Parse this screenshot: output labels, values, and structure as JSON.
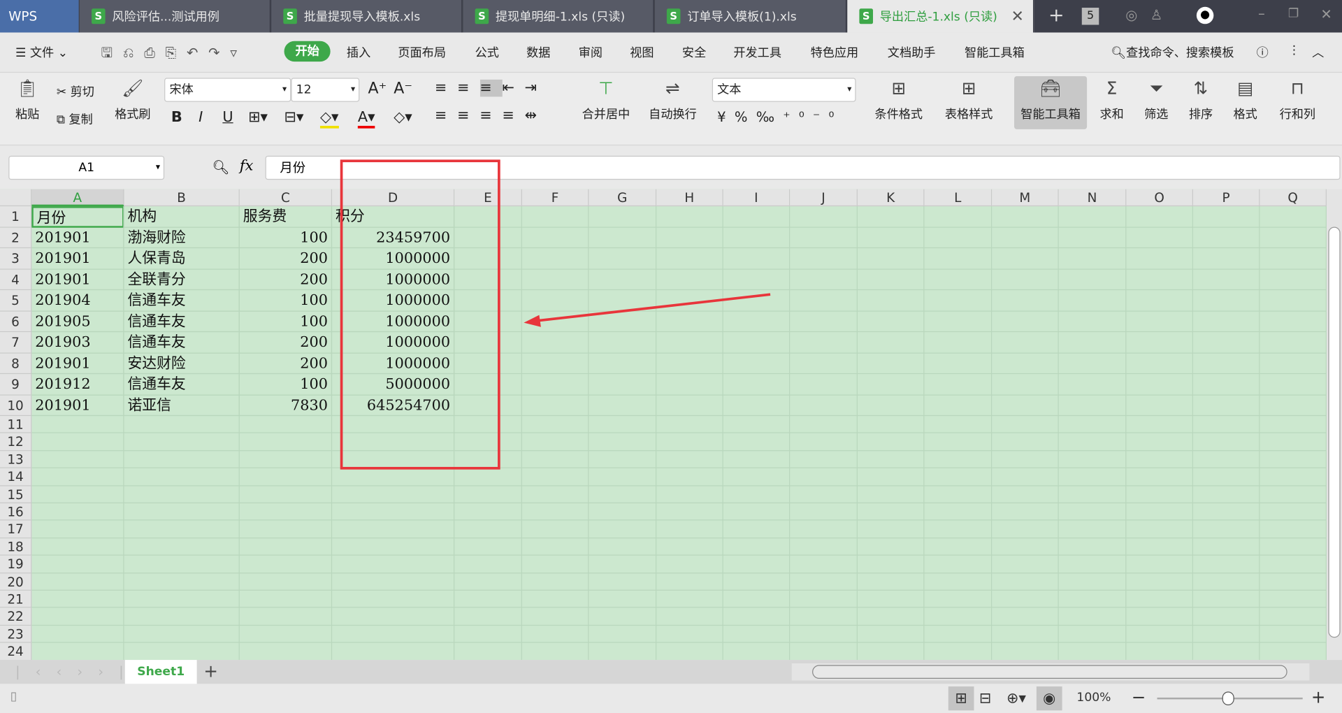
{
  "app": {
    "logo": "WPS"
  },
  "tabs": [
    {
      "label": "风险评估...测试用例"
    },
    {
      "label": "批量提现导入模板.xls"
    },
    {
      "label": "提现单明细-1.xls (只读)"
    },
    {
      "label": "订单导入模板(1).xls"
    },
    {
      "label": "导出汇总-1.xls (只读)"
    }
  ],
  "tabbar": {
    "count": "5"
  },
  "menu": {
    "file": "文件",
    "items": [
      "开始",
      "插入",
      "页面布局",
      "公式",
      "数据",
      "审阅",
      "视图",
      "安全",
      "开发工具",
      "特色应用",
      "文档助手",
      "智能工具箱"
    ],
    "search": "查找命令、搜索模板"
  },
  "ribbon": {
    "paste": "粘贴",
    "cut": "剪切",
    "copy": "复制",
    "format_painter": "格式刷",
    "font": "宋体",
    "size": "12",
    "merge": "合并居中",
    "wrap": "自动换行",
    "number_format": "文本",
    "cond_format": "条件格式",
    "table_style": "表格样式",
    "toolbox": "智能工具箱",
    "sum": "求和",
    "filter": "筛选",
    "sort": "排序",
    "format": "格式",
    "rowcol": "行和列"
  },
  "formula_bar": {
    "cell_ref": "A1",
    "fx": "fx",
    "value": "月份"
  },
  "columns": [
    "A",
    "B",
    "C",
    "D",
    "E",
    "F",
    "G",
    "H",
    "I",
    "J",
    "K",
    "L",
    "M",
    "N",
    "O",
    "P",
    "Q"
  ],
  "rows": [
    [
      "月份",
      "机构",
      "服务费",
      "积分"
    ],
    [
      "201901",
      "渤海财险",
      "100",
      "23459700"
    ],
    [
      "201901",
      "人保青岛",
      "200",
      "1000000"
    ],
    [
      "201901",
      "全联青分",
      "200",
      "1000000"
    ],
    [
      "201904",
      "信通车友",
      "100",
      "1000000"
    ],
    [
      "201905",
      "信通车友",
      "100",
      "1000000"
    ],
    [
      "201903",
      "信通车友",
      "200",
      "1000000"
    ],
    [
      "201901",
      "安达财险",
      "200",
      "1000000"
    ],
    [
      "201912",
      "信通车友",
      "100",
      "5000000"
    ],
    [
      "201901",
      "诺亚信",
      "7830",
      "645254700"
    ]
  ],
  "row_count": 24,
  "sheet": {
    "name": "Sheet1"
  },
  "status": {
    "zoom": "100%"
  },
  "colors": {
    "accent": "#3ea84a",
    "grid": "#cce8cf",
    "annotation": "#e8353b"
  }
}
